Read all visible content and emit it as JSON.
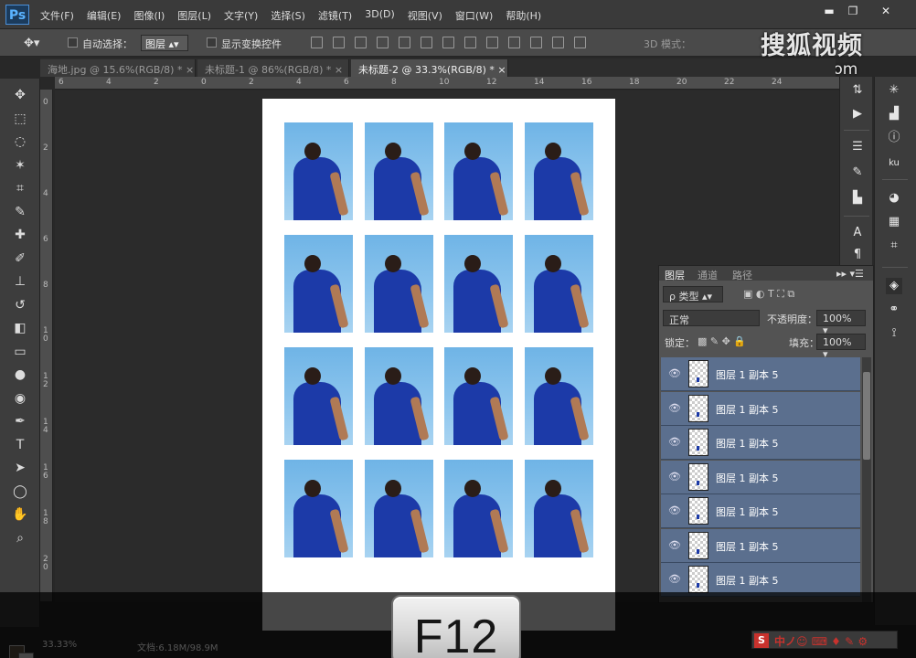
{
  "app": {
    "logo": "Ps"
  },
  "menu": [
    "文件(F)",
    "编辑(E)",
    "图像(I)",
    "图层(L)",
    "文字(Y)",
    "选择(S)",
    "滤镜(T)",
    "3D(D)",
    "视图(V)",
    "窗口(W)",
    "帮助(H)"
  ],
  "window_controls": {
    "minimize": "▬",
    "restore": "❐",
    "close": "✕"
  },
  "options": {
    "auto_select_label": "自动选择：",
    "auto_select_value": "图层",
    "show_transform_label": "显示变换控件",
    "mode_3d_label": "3D 模式："
  },
  "watermark": {
    "brand": "搜狐视频",
    "url": "tv.sohu.com"
  },
  "tabs": [
    {
      "label": "海地.jpg @ 15.6%(RGB/8) *",
      "close": "×"
    },
    {
      "label": "未标题-1 @ 86%(RGB/8) *",
      "close": "×"
    },
    {
      "label": "未标题-2 @ 33.3%(RGB/8) *",
      "close": "×"
    }
  ],
  "rulers": {
    "h": [
      "6",
      "4",
      "2",
      "0",
      "2",
      "4",
      "6",
      "8",
      "10",
      "12",
      "14",
      "16",
      "18",
      "20",
      "22",
      "24"
    ],
    "v": [
      "0",
      "2",
      "4",
      "6",
      "8",
      "1\n0",
      "1\n2",
      "1\n4",
      "1\n6",
      "1\n8",
      "2\n0"
    ]
  },
  "tools": [
    "move-tool",
    "marquee-tool",
    "lasso-tool",
    "magic-wand-tool",
    "crop-tool",
    "eyedropper-tool",
    "healing-tool",
    "brush-tool",
    "stamp-tool",
    "history-brush-tool",
    "eraser-tool",
    "gradient-tool",
    "blur-tool",
    "dodge-tool",
    "pen-tool",
    "type-tool",
    "path-select-tool",
    "ellipse-tool",
    "hand-tool",
    "zoom-tool"
  ],
  "tool_glyphs": [
    "✥",
    "⬚",
    "◌",
    "✶",
    "⌗",
    "✎",
    "✚",
    "✐",
    "⊥",
    "↺",
    "◧",
    "▭",
    "●",
    "◉",
    "✒",
    "T",
    "➤",
    "◯",
    "✋",
    "⌕"
  ],
  "layers_panel": {
    "tabs": [
      "图层",
      "通道",
      "路径"
    ],
    "filter_label": "ρ 类型",
    "blend_mode": "正常",
    "opacity_label": "不透明度：",
    "opacity_value": "100%",
    "lock_label": "锁定：",
    "fill_label": "填充：",
    "fill_value": "100%",
    "layers": [
      {
        "name": "图层 1 副本 5"
      },
      {
        "name": "图层 1 副本 5"
      },
      {
        "name": "图层 1 副本 5"
      },
      {
        "name": "图层 1 副本 5"
      },
      {
        "name": "图层 1 副本 5"
      },
      {
        "name": "图层 1 副本 5"
      },
      {
        "name": "图层 1 副本 5"
      }
    ]
  },
  "status": {
    "zoom": "33.33%",
    "doc": "文档:6.18M/98.9M"
  },
  "ime": {
    "s": "S",
    "text": "中ノ☺ ⌨ ♦ ✎ ⚙"
  },
  "key_overlay": "F12"
}
